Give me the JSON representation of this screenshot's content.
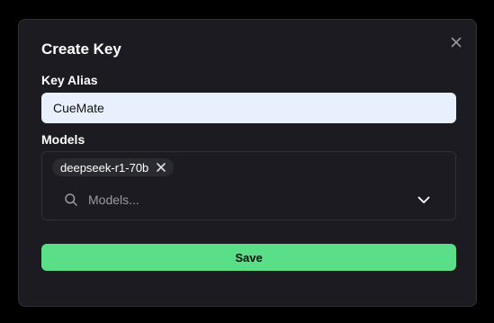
{
  "modal": {
    "title": "Create Key",
    "close_icon": "close-icon"
  },
  "key_alias": {
    "label": "Key Alias",
    "value": "CueMate"
  },
  "models": {
    "label": "Models",
    "selected": [
      {
        "label": "deepseek-r1-70b",
        "remove_icon": "close-icon"
      }
    ],
    "search_placeholder": "Models...",
    "search_icon": "search-icon",
    "dropdown_icon": "chevron-down-icon"
  },
  "save_button": {
    "label": "Save"
  },
  "colors": {
    "modal_background": "#1b1b21",
    "input_background": "#e8f0fe",
    "save_button": "#5ade88",
    "chip_background": "#2a2a31"
  }
}
